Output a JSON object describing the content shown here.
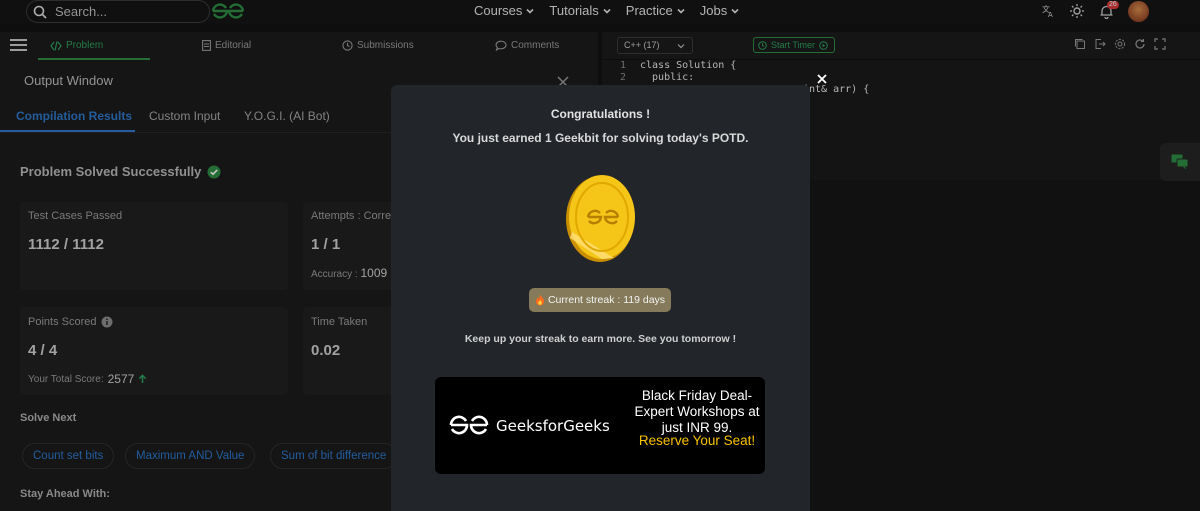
{
  "topbar": {
    "search_placeholder": "Search...",
    "nav": [
      "Courses",
      "Tutorials",
      "Practice",
      "Jobs"
    ],
    "notification_count": "26"
  },
  "left_tabs": {
    "problem": "Problem",
    "editorial": "Editorial",
    "submissions": "Submissions",
    "comments": "Comments"
  },
  "output": {
    "title": "Output Window",
    "tabs": [
      "Compilation Results",
      "Custom Input",
      "Y.O.G.I. (AI Bot)"
    ],
    "status": "Problem Solved Successfully",
    "cards": {
      "test_cases_label": "Test Cases Passed",
      "test_cases_value": "1112 / 1112",
      "attempts_label": "Attempts : Corre",
      "attempts_value": "1 / 1",
      "accuracy_label": "Accuracy :",
      "accuracy_value": "1009",
      "points_label": "Points Scored",
      "points_value": "4 / 4",
      "total_score_label": "Your Total Score:",
      "total_score_value": "2577",
      "time_label": "Time Taken",
      "time_value": "0.02"
    },
    "solve_next_title": "Solve Next",
    "solve_next": [
      "Count set bits",
      "Maximum AND Value",
      "Sum of bit difference"
    ],
    "stay_ahead": "Stay Ahead With:"
  },
  "editor": {
    "language": "C++ (17)",
    "timer_label": "Start Timer",
    "line1_no": "1",
    "line2_no": "2",
    "line1": "class Solution {",
    "line2": "  public:",
    "line3_partial": "int& arr) {"
  },
  "modal": {
    "title": "Congratulations !",
    "subtitle": "You just earned 1 Geekbit for solving today's POTD.",
    "streak": "Current streak : 119 days",
    "keep_up": "Keep up your streak to earn more. See you tomorrow !",
    "ad": {
      "brand": "GeeksforGeeks",
      "text": "Black Friday Deal- Expert Workshops at just INR 99.",
      "cta": "Reserve Your Seat!"
    }
  },
  "colors": {
    "brand_green": "#2f8d46",
    "link_blue": "#2f77c9",
    "coin_gold": "#f5c518",
    "ad_cta": "#f7c100"
  }
}
